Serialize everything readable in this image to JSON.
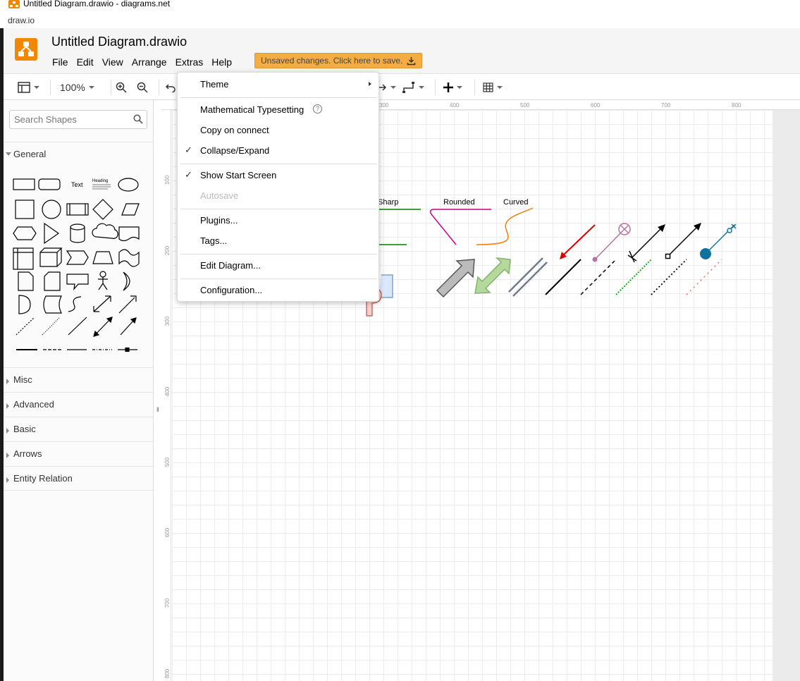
{
  "window": {
    "title": "Untitled Diagram.drawio - diagrams.net",
    "url": "draw.io"
  },
  "header": {
    "doc_title": "Untitled Diagram.drawio",
    "menus": [
      "File",
      "Edit",
      "View",
      "Arrange",
      "Extras",
      "Help"
    ],
    "save_notice": "Unsaved changes. Click here to save."
  },
  "toolbar": {
    "zoom": "100%"
  },
  "sidebar": {
    "search_placeholder": "Search Shapes",
    "sections": [
      "General",
      "Misc",
      "Advanced",
      "Basic",
      "Arrows",
      "Entity Relation"
    ],
    "general_text_shape": "Text",
    "general_heading_shape": "Heading"
  },
  "rulers": {
    "top": [
      "300",
      "400",
      "500",
      "600",
      "700",
      "800"
    ],
    "left": [
      "100",
      "200",
      "300",
      "400",
      "500",
      "600",
      "700",
      "800"
    ]
  },
  "canvas": {
    "style_labels": [
      "Sharp",
      "Rounded",
      "Curved"
    ]
  },
  "extras_menu": {
    "items": [
      {
        "label": "Theme",
        "submenu": true
      },
      {
        "label": "Mathematical Typesetting",
        "help": true
      },
      {
        "label": "Copy on connect"
      },
      {
        "label": "Collapse/Expand",
        "checked": true
      },
      {
        "label": "Show Start Screen",
        "checked": true
      },
      {
        "label": "Autosave",
        "disabled": true
      },
      {
        "label": "Plugins..."
      },
      {
        "label": "Tags..."
      },
      {
        "label": "Edit Diagram..."
      },
      {
        "label": "Configuration..."
      }
    ]
  },
  "colors": {
    "accent": "#f08705",
    "save_bg": "#f4ad42"
  }
}
